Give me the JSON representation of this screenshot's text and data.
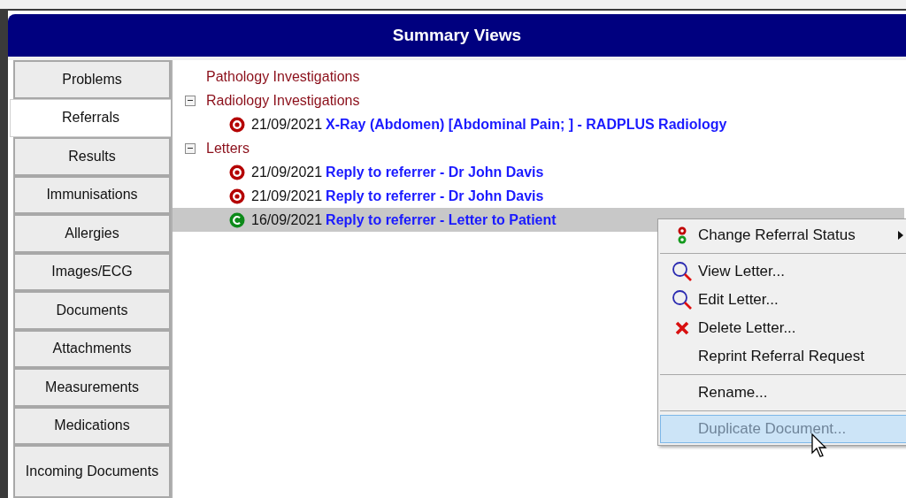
{
  "window": {
    "title": "Summary Views"
  },
  "tabs": [
    {
      "label": "Problems",
      "selected": false
    },
    {
      "label": "Referrals",
      "selected": true
    },
    {
      "label": "Results",
      "selected": false
    },
    {
      "label": "Immunisations",
      "selected": false
    },
    {
      "label": "Allergies",
      "selected": false
    },
    {
      "label": "Images/ECG",
      "selected": false
    },
    {
      "label": "Documents",
      "selected": false
    },
    {
      "label": "Attachments",
      "selected": false
    },
    {
      "label": "Measurements",
      "selected": false
    },
    {
      "label": "Medications",
      "selected": false
    },
    {
      "label": "Incoming Documents",
      "selected": false
    }
  ],
  "tree": [
    {
      "label": "Pathology Investigations"
    },
    {
      "label": "Radiology Investigations",
      "expanded": true,
      "children": [
        {
          "kind": "open",
          "date": "21/09/2021",
          "title": "X-Ray (Abdomen) [Abdominal Pain; ] - RADPLUS Radiology",
          "selected": false
        }
      ]
    },
    {
      "label": "Letters",
      "expanded": true,
      "children": [
        {
          "kind": "open",
          "date": "21/09/2021",
          "title": "Reply to referrer - Dr John Davis",
          "selected": false
        },
        {
          "kind": "open",
          "date": "21/09/2021",
          "title": "Reply to referrer - Dr John Davis",
          "selected": false
        },
        {
          "kind": "completed",
          "date": "16/09/2021",
          "title": "Reply to referrer - Letter to Patient",
          "selected": true
        }
      ]
    }
  ],
  "context_menu": [
    {
      "kind": "status",
      "label": "Change Referral Status",
      "submenu": true,
      "disabled": false,
      "selected": false
    },
    {
      "kind": "separator"
    },
    {
      "kind": "search",
      "label": "View Letter...",
      "disabled": false,
      "selected": false
    },
    {
      "kind": "search",
      "label": "Edit Letter...",
      "disabled": false,
      "selected": false
    },
    {
      "kind": "delete",
      "label": "Delete Letter...",
      "disabled": false,
      "selected": false
    },
    {
      "kind": "plain",
      "label": "Reprint Referral Request",
      "disabled": false,
      "selected": false
    },
    {
      "kind": "separator"
    },
    {
      "kind": "plain",
      "label": "Rename...",
      "disabled": false,
      "selected": false
    },
    {
      "kind": "separator"
    },
    {
      "kind": "plain",
      "label": "Duplicate Document...",
      "disabled": true,
      "selected": true
    }
  ]
}
